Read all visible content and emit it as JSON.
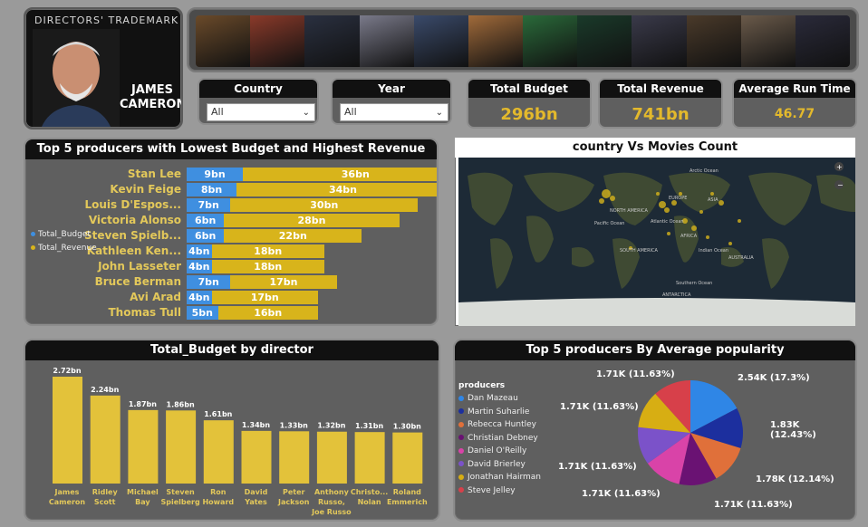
{
  "director": {
    "brand": "DIRECTORS' TRADEMARK",
    "name_line1": "JAMES",
    "name_line2": "CAMERON"
  },
  "banner": {
    "tile_colors": [
      "#6a4a2a",
      "#8a3a2a",
      "#2a3040",
      "#7a7a8a",
      "#3a4a6a",
      "#a06a3a",
      "#2a6a3a",
      "#1a3a2a",
      "#3a3a4a",
      "#4a3a2a",
      "#6a5a4a",
      "#2a2a3a"
    ]
  },
  "slicers": {
    "country": {
      "label": "Country",
      "value": "All"
    },
    "year": {
      "label": "Year",
      "value": "All"
    }
  },
  "kpis": {
    "total_budget": {
      "label": "Total Budget",
      "value": "296bn"
    },
    "total_revenue": {
      "label": "Total Revenue",
      "value": "741bn"
    },
    "avg_runtime": {
      "label": "Average Run Time",
      "value": "46.77"
    }
  },
  "producers_chart": {
    "title": "Top 5 producers with Lowest Budget and Highest Revenue",
    "legend": [
      "Total_Budget",
      "Total_Revenue"
    ],
    "colors": {
      "budget": "#3f8fe0",
      "revenue": "#d8b41b"
    }
  },
  "map": {
    "title": "country Vs Movies Count",
    "labels": [
      "NORTH AMERICA",
      "EUROPE",
      "ASIA",
      "AFRICA",
      "SOUTH AMERICA",
      "AUSTRALIA",
      "ANTARCTICA",
      "Atlantic Ocean",
      "Pacific Ocean",
      "Indian Ocean",
      "Arctic Ocean",
      "Southern Ocean"
    ]
  },
  "budget_chart": {
    "title": "Total_Budget by director"
  },
  "popularity_chart": {
    "title": "Top 5 producers By Average popularity",
    "legend_title": "producers"
  },
  "chart_data": [
    {
      "type": "bar",
      "orientation": "horizontal",
      "title": "Top 5 producers with Lowest Budget and Highest Revenue",
      "categories": [
        "Stan Lee",
        "Kevin Feige",
        "Louis D'Espos...",
        "Victoria Alonso",
        "Steven Spielb...",
        "Kathleen Ken...",
        "John Lasseter",
        "Bruce Berman",
        "Avi Arad",
        "Thomas Tull"
      ],
      "series": [
        {
          "name": "Total_Budget",
          "values": [
            9,
            8,
            7,
            6,
            6,
            4,
            4,
            7,
            4,
            5
          ],
          "labels": [
            "9bn",
            "8bn",
            "7bn",
            "6bn",
            "6bn",
            "4bn",
            "4bn",
            "7bn",
            "4bn",
            "5bn"
          ]
        },
        {
          "name": "Total_Revenue",
          "values": [
            36,
            34,
            30,
            28,
            22,
            18,
            18,
            17,
            17,
            16
          ],
          "labels": [
            "36bn",
            "34bn",
            "30bn",
            "28bn",
            "22bn",
            "18bn",
            "18bn",
            "17bn",
            "17bn",
            "16bn"
          ]
        }
      ],
      "stacked": true,
      "legend": "left"
    },
    {
      "type": "bar",
      "title": "Total_Budget by director",
      "categories": [
        [
          "James",
          "Cameron"
        ],
        [
          "Ridley",
          "Scott"
        ],
        [
          "Michael",
          "Bay"
        ],
        [
          "Steven",
          "Spielberg"
        ],
        [
          "Ron",
          "Howard"
        ],
        [
          "David",
          "Yates"
        ],
        [
          "Peter",
          "Jackson"
        ],
        [
          "Anthony",
          "Russo,",
          "Joe Russo"
        ],
        [
          "Christo...",
          "Nolan"
        ],
        [
          "Roland",
          "Emmerich"
        ]
      ],
      "values": [
        2.72,
        2.24,
        1.87,
        1.86,
        1.61,
        1.34,
        1.33,
        1.32,
        1.31,
        1.3
      ],
      "labels": [
        "2.72bn",
        "2.24bn",
        "1.87bn",
        "1.86bn",
        "1.61bn",
        "1.34bn",
        "1.33bn",
        "1.32bn",
        "1.31bn",
        "1.30bn"
      ],
      "color": "#e3c23a"
    },
    {
      "type": "pie",
      "title": "Top 5 producers By Average popularity",
      "slices": [
        {
          "name": "Dan Mazeau",
          "value": 2.54,
          "label": "2.54K (17.3%)",
          "color": "#2f86e6"
        },
        {
          "name": "Martin Suharlie",
          "value": 1.83,
          "label": "1.83K (12.43%)",
          "color": "#1c2f9e"
        },
        {
          "name": "Rebecca Huntley",
          "value": 1.78,
          "label": "1.78K (12.14%)",
          "color": "#e0703a"
        },
        {
          "name": "Christian Debney",
          "value": 1.71,
          "label": "1.71K (11.63%)",
          "color": "#6a1273"
        },
        {
          "name": "Daniel O'Reilly",
          "value": 1.71,
          "label": "1.71K (11.63%)",
          "color": "#d943a8"
        },
        {
          "name": "David Brierley",
          "value": 1.71,
          "label": "1.71K (11.63%)",
          "color": "#7b52c9"
        },
        {
          "name": "Jonathan Hairman",
          "value": 1.71,
          "label": "1.71K (11.63%)",
          "color": "#d7ae13"
        },
        {
          "name": "Steve Jelley",
          "value": 1.71,
          "label": "1.71K (11.63%)",
          "color": "#d7404a"
        }
      ]
    }
  ]
}
